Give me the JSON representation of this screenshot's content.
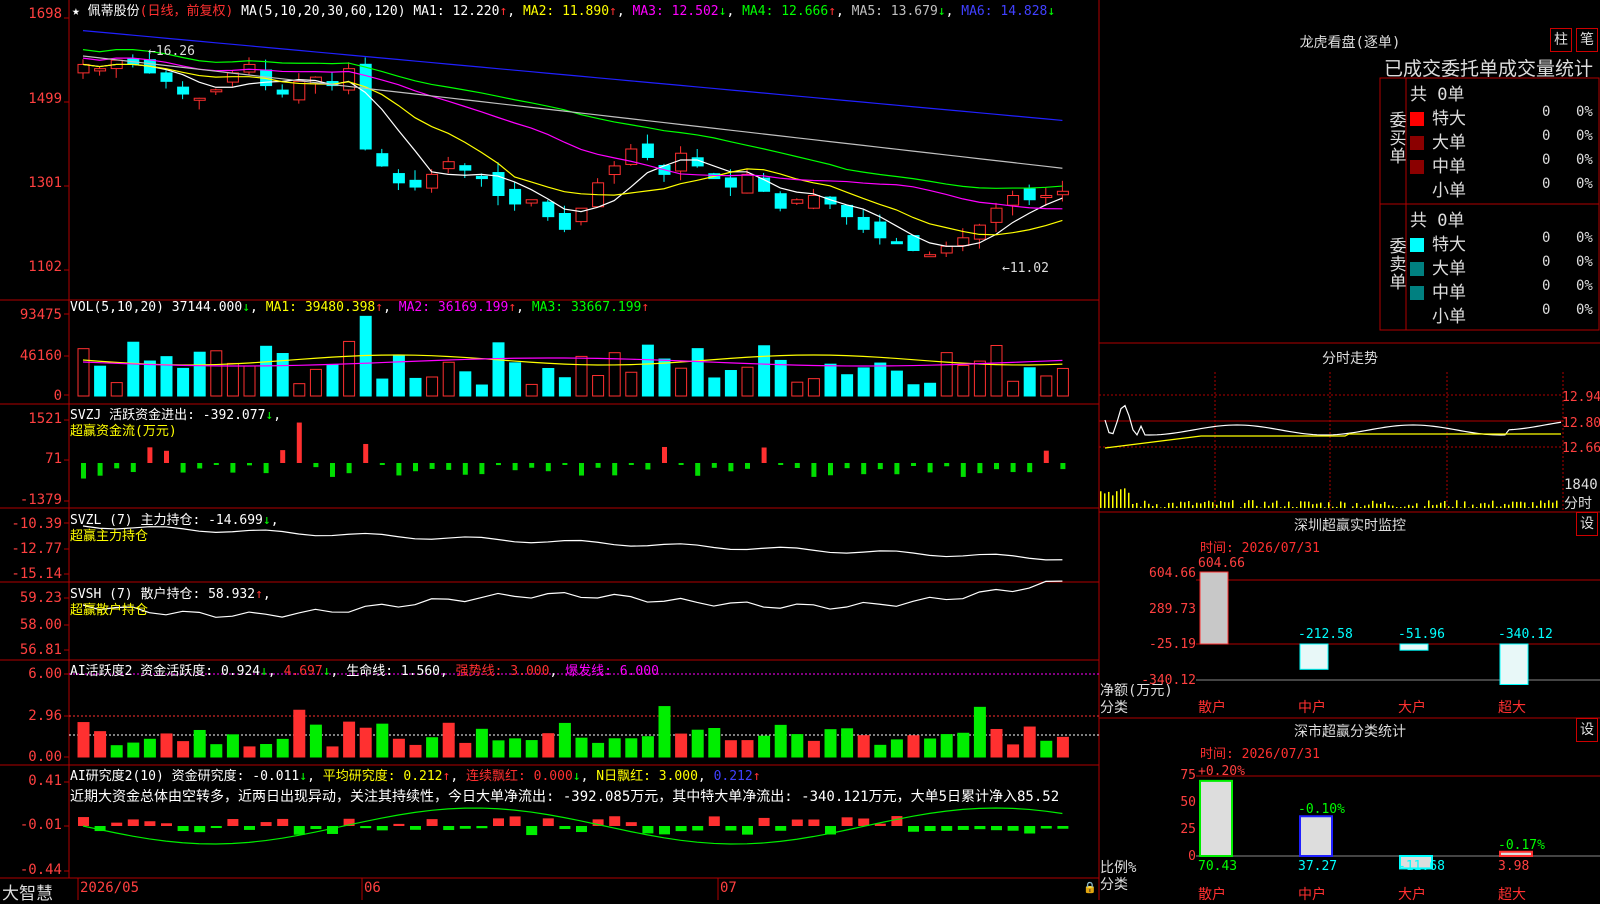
{
  "colors": {
    "up": "#ff3030",
    "down": "#00ffff",
    "grid": "#b00000",
    "ma1": "#ffffff",
    "ma2": "#ffff00",
    "ma3": "#ff00ff",
    "ma4": "#00ff00",
    "ma5": "#c0c0c0",
    "ma6": "#2020ff"
  },
  "app": {
    "name": "大智慧"
  },
  "main": {
    "stock": "佩蒂股份",
    "period": "(日线，前复权)",
    "ma_label": "MA(5,10,20,30,60,120)",
    "ma1": "MA1: 12.220",
    "ma2": "MA2: 11.890",
    "ma3": "MA3: 12.502",
    "ma4": "MA4: 12.666",
    "ma5": "MA5: 13.679",
    "ma6": "MA6: 14.828",
    "y_labels": [
      "1698",
      "1499",
      "1301",
      "1102"
    ],
    "hi_mark": "16.26",
    "lo_mark": "11.02"
  },
  "vol": {
    "title": "VOL(5,10,20)",
    "value": "37144.000",
    "ma1": "MA1: 39480.398",
    "ma2": "MA2: 36169.199",
    "ma3": "MA3: 33667.199",
    "y_labels": [
      "93475",
      "46160",
      "0"
    ]
  },
  "svzj": {
    "title": "SVZJ  活跃资金进出: -392.077",
    "sub": "超赢资金流(万元)",
    "y_labels": [
      "1521",
      "71",
      "-1379"
    ]
  },
  "svzl": {
    "title": "SVZL (7) 主力持仓: -14.699",
    "sub": "超赢主力持仓",
    "y_labels": [
      "-10.39",
      "-12.77",
      "-15.14"
    ]
  },
  "svsh": {
    "title": "SVSH (7) 散户持仓: 58.932",
    "sub": "超赢散户持仓",
    "y_labels": [
      "59.23",
      "58.00",
      "56.81"
    ]
  },
  "ai1": {
    "title": "AI活跃度2 资金活跃度: 0.924",
    "v2": "4.697",
    "life": "生命线: 1.560",
    "strong": "强势线: 3.000",
    "burst": "爆发线: 6.000",
    "y_labels": [
      "6.00",
      "2.96",
      "0.00"
    ]
  },
  "ai2": {
    "title": "AI研究度2(10) 资金研究度: -0.011",
    "avg": "平均研究度: 0.212",
    "red": "连续飘红: 0.000",
    "nred": "N日飘红: 3.000",
    "last": "0.212",
    "desc": "近期大资金总体由空转多，近两日出现异动，关注其持续性，今日大单净流出: -392.085万元，其中特大单净流出: -340.121万元，大单5日累计净入85.52",
    "y_labels": [
      "0.41",
      "-0.01",
      "-0.44"
    ]
  },
  "xaxis": [
    "2026/05",
    "06",
    "07"
  ],
  "right": {
    "lhb_title": "龙虎看盘(逐单)",
    "btn1": "柱",
    "btn2": "笔",
    "tabs": "已成交委托单成交量统计",
    "buy_label": "委买单",
    "sell_label": "委卖单",
    "buy_total": "共 0单",
    "sell_total": "共 0单",
    "rows_buy": [
      {
        "name": "特大",
        "n": "0",
        "p": "0%"
      },
      {
        "name": "大单",
        "n": "0",
        "p": "0%"
      },
      {
        "name": "中单",
        "n": "0",
        "p": "0%"
      },
      {
        "name": "小单",
        "n": "0",
        "p": "0%"
      }
    ],
    "rows_sell": [
      {
        "name": "特大",
        "n": "0",
        "p": "0%"
      },
      {
        "name": "大单",
        "n": "0",
        "p": "0%"
      },
      {
        "name": "中单",
        "n": "0",
        "p": "0%"
      },
      {
        "name": "小单",
        "n": "0",
        "p": "0%"
      }
    ],
    "fenshi_title": "分时走势",
    "fenshi_y": [
      "12.94",
      "12.80",
      "12.66"
    ],
    "fenshi_vol": "1840",
    "fenshi_unit": "分时",
    "sz_title": "深圳超赢实时监控",
    "set": "设",
    "sz_time": "时间: 2026/07/31",
    "sz_y": [
      "604.66",
      "289.73",
      "-25.19",
      "-340.12"
    ],
    "sz_bars": [
      {
        "label": "散户",
        "value": "604.66"
      },
      {
        "label": "中户",
        "value": "-212.58"
      },
      {
        "label": "大户",
        "value": "-51.96"
      },
      {
        "label": "超大",
        "value": "-340.12"
      }
    ],
    "sz_unit": "净额(万元)",
    "sz_cat": "分类",
    "st_title": "深市超赢分类统计",
    "st_time": "时间: 2026/07/31",
    "st_y": [
      "75",
      "50",
      "25",
      "0"
    ],
    "st_bars": [
      {
        "label": "散户",
        "top": "+0.20%",
        "value": "70.43"
      },
      {
        "label": "中户",
        "top": "-0.10%",
        "value": "37.27"
      },
      {
        "label": "大户",
        "top": "",
        "value": "-11.68"
      },
      {
        "label": "超大",
        "top": "-0.17%",
        "value": "3.98"
      }
    ],
    "st_unit": "比例%",
    "st_cat": "分类"
  }
}
